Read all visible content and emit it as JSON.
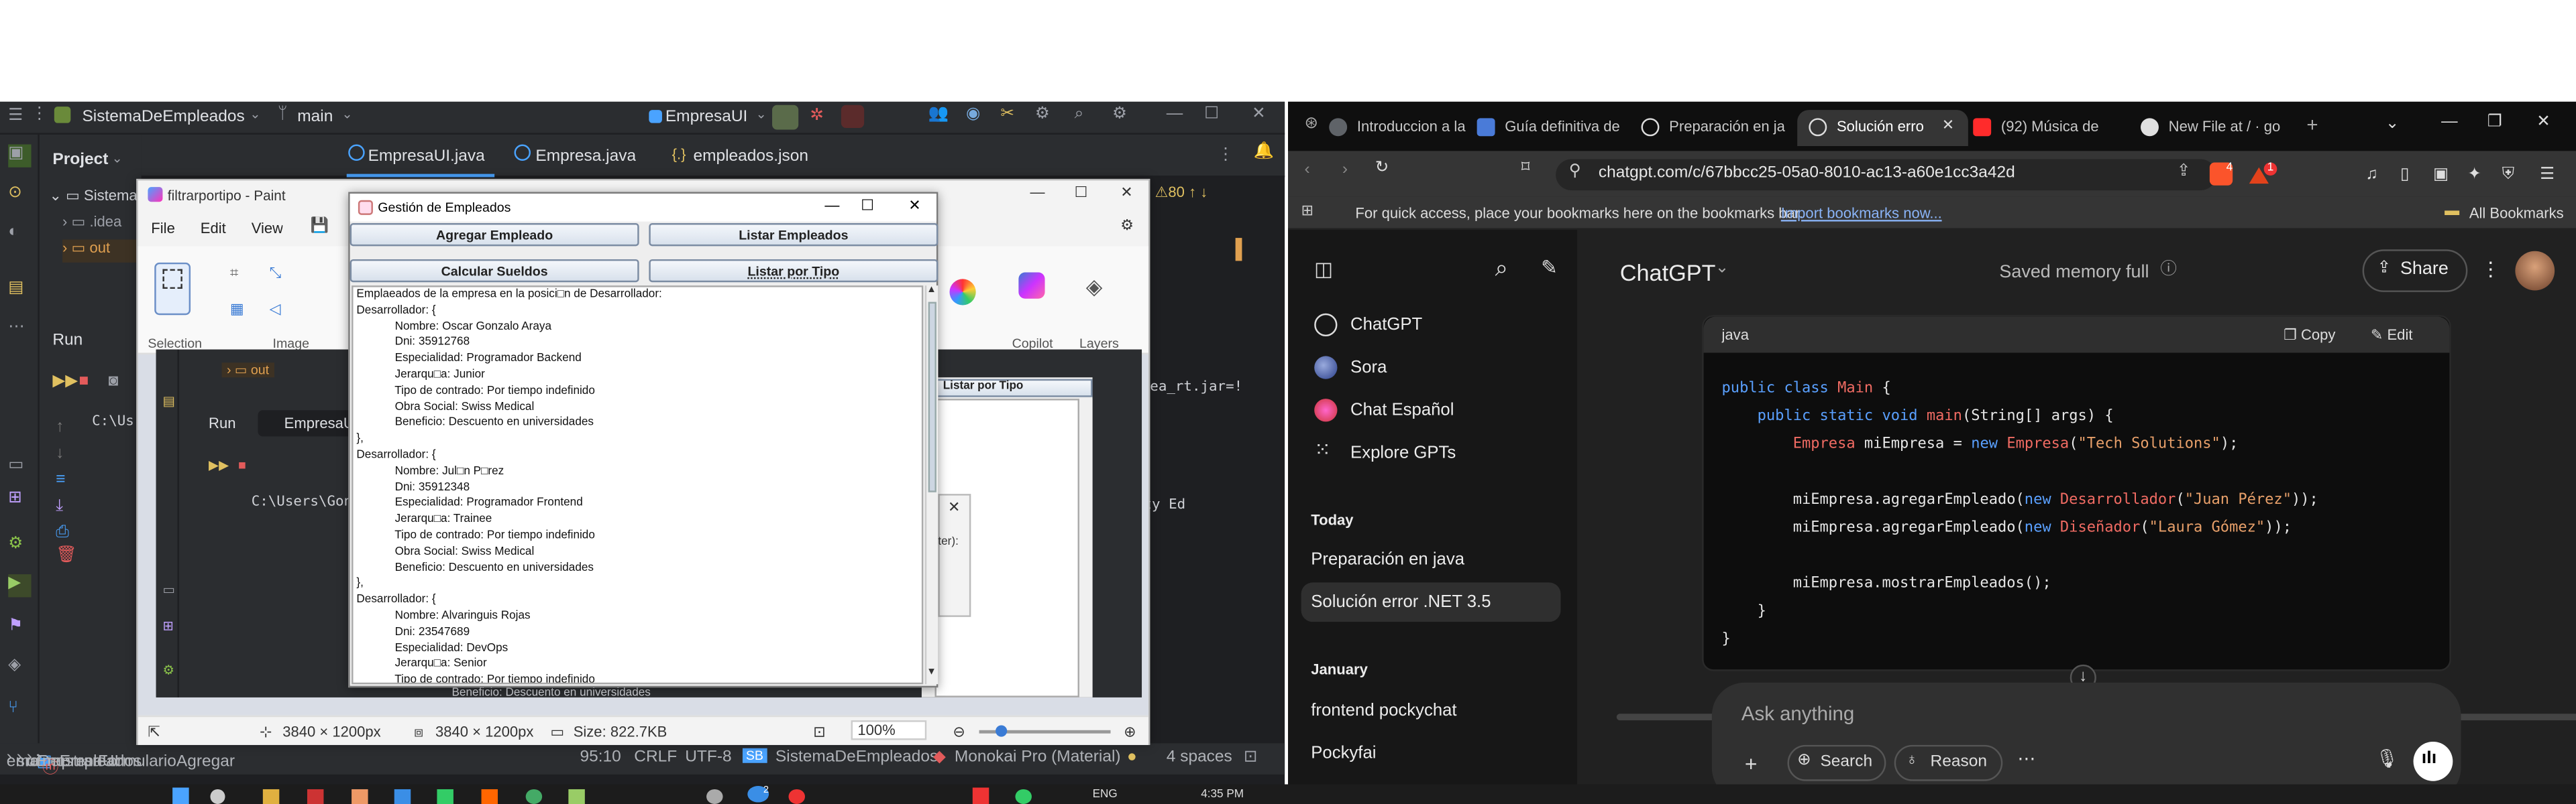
{
  "ide": {
    "project": "SistemaDeEmpleados",
    "branch": "main",
    "run_config": "EmpresaUI",
    "project_panel_label": "Project",
    "tree_items": [
      "SistemaDeEmpleados",
      ".idea",
      "out"
    ],
    "run_label": "Run",
    "console_path": "C:\\Us",
    "editor_tabs": [
      {
        "label": "EmpresaUI.java",
        "color": "#5aa0ff"
      },
      {
        "label": "Empresa.java",
        "color": "#5aa0ff"
      },
      {
        "label": "empleados.json",
        "color": "#e0c060"
      }
    ],
    "warning_count": "80",
    "status": {
      "breadcrumbs": [
        "emaDeEmpleados",
        "src",
        "ui",
        "EmpresaUI",
        "mostrarFormularioAgregar"
      ],
      "position": "95:10",
      "line_ending": "CRLF",
      "encoding": "UTF-8",
      "module": "SistemaDeEmpleados",
      "theme": "Monokai Pro (Material)",
      "indent": "4 spaces"
    },
    "console_fragment": "ea_rt.jar=!",
    "console_fragment2": "ty Ed"
  },
  "paint": {
    "title": "filtrarportipo - Paint",
    "menu": [
      "File",
      "Edit",
      "View"
    ],
    "groups": [
      "Selection",
      "Image",
      "Copilot",
      "Layers"
    ],
    "status": {
      "size1": "3840 × 1200px",
      "size2": "3840 × 1200px",
      "filesize": "Size: 822.7KB",
      "zoom": "100%"
    },
    "inner": {
      "tree_item": "out",
      "run_label": "Run",
      "tab_label": "EmpresaU",
      "console_path": "C:\\Users\\Gon",
      "back_button": "Listar por Tipo",
      "frag_ter": "ter):",
      "frag_bottom": "Beneficio: Descuento en universidades"
    }
  },
  "dialog": {
    "title": "Gestión de Empleados",
    "buttons": [
      "Agregar Empleado",
      "Listar Empleados",
      "Calcular Sueldos",
      "Listar por Tipo"
    ],
    "lines": [
      "Emplaeados de la empresa en la posici□n de Desarrollador:",
      "Desarrollador: {",
      "            Nombre: Oscar Gonzalo Araya",
      "            Dni: 35912768",
      "            Especialidad: Programador Backend",
      "            Jerarqu□a: Junior",
      "            Tipo de contrado: Por tiempo indefinido",
      "            Obra Social: Swiss Medical",
      "            Beneficio: Descuento en universidades",
      "},",
      "Desarrollador: {",
      "            Nombre: Jul□n P□rez",
      "            Dni: 35912348",
      "            Especialidad: Programador Frontend",
      "            Jerarqu□a: Trainee",
      "            Tipo de contrado: Por tiempo indefinido",
      "            Obra Social: Swiss Medical",
      "            Beneficio: Descuento en universidades",
      "},",
      "Desarrollador: {",
      "            Nombre: Alvaringuis Rojas",
      "            Dni: 23547689",
      "            Especialidad: DevOps",
      "            Jerarqu□a: Senior",
      "            Tipo de contrado: Por tiempo indefinido"
    ]
  },
  "browser": {
    "tabs": [
      {
        "label": "Introduccion a la",
        "color": "#9aa0a6"
      },
      {
        "label": "Guía definitiva de",
        "color": "#4a7bd8"
      },
      {
        "label": "Preparación en ja",
        "color": "#d0d0d0"
      },
      {
        "label": "Solución erro",
        "color": "#d0d0d0"
      },
      {
        "label": "(92) Música de",
        "color": "#ff2b2b"
      },
      {
        "label": "New File at / · go",
        "color": "#e0e0e0"
      }
    ],
    "url": "chatgpt.com/c/67bbcc25-05a0-8010-ac13-a60e1cc3a42d",
    "brave_badge": "4",
    "alert_badge": "1",
    "bookmarks_hint": "For quick access, place your bookmarks here on the bookmarks bar.",
    "import_link": "Import bookmarks now...",
    "all_bookmarks": "All Bookmarks"
  },
  "chatgpt": {
    "model": "ChatGPT",
    "memory": "Saved memory full",
    "share": "Share",
    "nav": [
      "ChatGPT",
      "Sora",
      "Chat Español",
      "Explore GPTs"
    ],
    "today_label": "Today",
    "today": [
      "Preparación en java",
      "Solución error .NET 3.5"
    ],
    "january_label": "January",
    "january": [
      "frontend pockychat",
      "Pockyfai"
    ],
    "code_lang": "java",
    "copy": "Copy",
    "edit": "Edit",
    "code_lines": [
      "public class Main {",
      "    public static void main(String[] args) {",
      "        Empresa miEmpresa = new Empresa(\"Tech Solutions\");",
      "",
      "        miEmpresa.agregarEmpleado(new Desarrollador(\"Juan Pérez\"));",
      "        miEmpresa.agregarEmpleado(new Diseñador(\"Laura Gómez\"));",
      "",
      "        miEmpresa.mostrarEmpleados();",
      "    }",
      "}"
    ],
    "placeholder": "Ask anything",
    "search": "Search",
    "reason": "Reason"
  },
  "taskbar": {
    "lang": "ENG",
    "time": "4:35 PM",
    "badge": "2"
  }
}
